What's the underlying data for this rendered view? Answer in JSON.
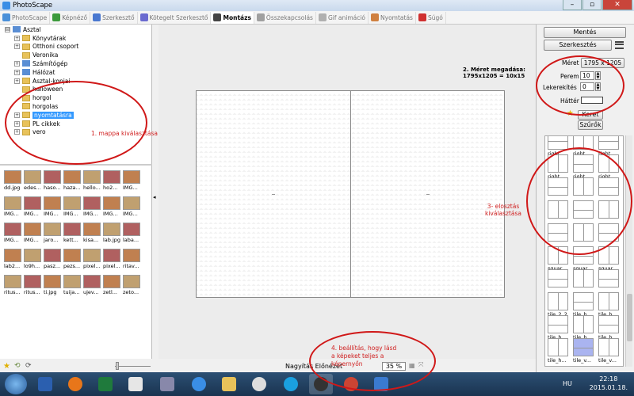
{
  "window": {
    "title": "PhotoScape",
    "close": "✕",
    "minimize": "–",
    "maximize": "▫"
  },
  "tabs": [
    {
      "label": "PhotoScape",
      "color": "#4a90d9"
    },
    {
      "label": "Képnéző",
      "color": "#3c9a3c"
    },
    {
      "label": "Szerkesztő",
      "color": "#4a78d0"
    },
    {
      "label": "Kötegelt Szerkesztő",
      "color": "#6a6ad0"
    },
    {
      "label": "Montázs",
      "color": "#444444",
      "active": true
    },
    {
      "label": "Összekapcsolás",
      "color": "#a0a0a0"
    },
    {
      "label": "Gif animáció",
      "color": "#b0b0b0"
    },
    {
      "label": "Nyomtatás",
      "color": "#d08040"
    },
    {
      "label": "Súgó",
      "color": "#d03030"
    }
  ],
  "tree": {
    "root": "Asztal",
    "items": [
      "Könyvtárak",
      "Otthoni csoport",
      "Veronika",
      "Számítógép",
      "Hálózat",
      "Asztal-konjai",
      "halloween",
      "horgol",
      "horgolas",
      "nyomtatásra",
      "PL cikkek",
      "vero"
    ],
    "selected": "nyomtatásra"
  },
  "thumbs": [
    "dd.jpg",
    "edes...",
    "haso...",
    "haza...",
    "hello...",
    "ho2...",
    "IMG...",
    "IMG...",
    "IMG...",
    "IMG...",
    "IMG...",
    "IMG...",
    "IMG...",
    "IMG...",
    "IMG...",
    "IMG...",
    "jaro...",
    "kett...",
    "kisa...",
    "lab.jpg",
    "laba...",
    "lab2...",
    "lo9h...",
    "pasz...",
    "pezs...",
    "pixel...",
    "pixel...",
    "ritav...",
    "ritus...",
    "ritus...",
    "ti.jpg",
    "tuija...",
    "ujev...",
    "zetl...",
    "zeto..."
  ],
  "right": {
    "save": "Mentés",
    "edit": "Szerkesztés",
    "size_label": "Méret",
    "size_value": "1795 x 1205",
    "margin_label": "Perem",
    "margin_value": "10",
    "round_label": "Lekerekítés",
    "round_value": "0",
    "bg_label": "Háttér",
    "frame": "Keret",
    "filters": "Szűrők",
    "layouts": [
      "right_...",
      "right_...",
      "right_...",
      "right_...",
      "right_...",
      "right_...",
      "",
      "",
      "",
      "",
      "",
      "",
      "",
      "",
      "",
      "squar...",
      "squar...",
      "squar...",
      "",
      "",
      "",
      "tile_2_2",
      "tile_h...",
      "tile_h...",
      "tile_h...",
      "tile_h...",
      "tile_h...",
      "tile_h...",
      "tile_v...",
      "tile_v..."
    ]
  },
  "bottom": {
    "left_label": "Nagyítás Előnézet",
    "zoom": "35 %"
  },
  "annotations": {
    "a1": "1. mappa kiválasztása",
    "a2_line1": "2. Méret megadása:",
    "a2_line2": "1795x1205 = 10x15",
    "a3_line1": "3- elosztás",
    "a3_line2": "kiválasztása",
    "a4_line1": "4. beállítás, hogy lásd",
    "a4_line2": "a képeket teljes a",
    "a4_line3": "képernyőn"
  },
  "taskbar": {
    "lang": "HU",
    "time": "22:18",
    "date": "2015.01.18."
  }
}
